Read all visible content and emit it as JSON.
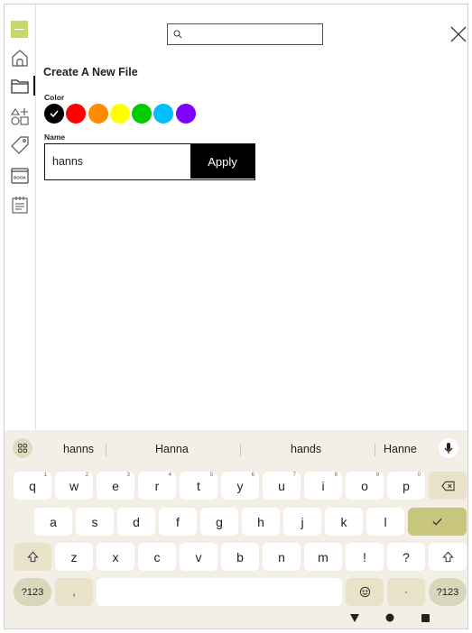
{
  "colors": {
    "accent": "#c8d96a",
    "swatches": [
      "#000000",
      "#ff0000",
      "#ff8c00",
      "#ffff00",
      "#00cc00",
      "#00bfff",
      "#8000ff"
    ],
    "keyboard_bg": "#f3efe6",
    "special_key": "#e7e2c8",
    "enter_key": "#c8c57f"
  },
  "sidebar": {
    "icons": [
      "home-icon",
      "folder-icon",
      "shapes-icon",
      "tag-icon",
      "book-icon",
      "notes-icon"
    ],
    "book_label": "BOOK"
  },
  "header": {
    "search_placeholder": ""
  },
  "form": {
    "title": "Create A New File",
    "color_label": "Color",
    "selected_color": "#000000",
    "name_label": "Name",
    "name_value": "hanns",
    "apply_label": "Apply"
  },
  "keyboard": {
    "suggestions": [
      "hanns",
      "Hanna",
      "hands",
      "Hanne"
    ],
    "row1": [
      "q",
      "w",
      "e",
      "r",
      "t",
      "y",
      "u",
      "i",
      "o",
      "p"
    ],
    "row1_hints": [
      "1",
      "2",
      "3",
      "4",
      "5",
      "6",
      "7",
      "8",
      "9",
      "0"
    ],
    "row2": [
      "a",
      "s",
      "d",
      "f",
      "g",
      "h",
      "j",
      "k",
      "l"
    ],
    "row3": [
      "z",
      "x",
      "c",
      "v",
      "b",
      "n",
      "m",
      "!",
      "?"
    ],
    "symbols_label": "?123",
    "comma": ",",
    "period": "·",
    "symbols_right_label": "?123"
  }
}
